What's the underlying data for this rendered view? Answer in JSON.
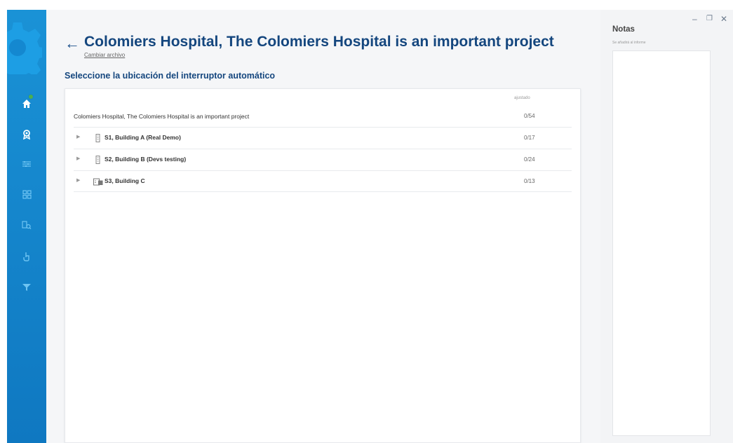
{
  "header": {
    "back_icon": "arrow-left-icon",
    "title": "Colomiers Hospital, The Colomiers Hospital is an important project",
    "change_file_link": "Cambiar archivo"
  },
  "section_title": "Seleccione la ubicación del interruptor automático",
  "table": {
    "column_header": "ajustado",
    "project": {
      "name": "Colomiers Hospital, The Colomiers Hospital is an important project",
      "count": "0/54"
    },
    "locations": [
      {
        "label": "S1, Building A (Real Demo)",
        "count": "0/17",
        "icon": "building-icon"
      },
      {
        "label": "S2, Building B (Devs testing)",
        "count": "0/24",
        "icon": "building-icon"
      },
      {
        "label": "S3, Building C",
        "count": "0/13",
        "icon": "folder-building-icon"
      }
    ]
  },
  "notes": {
    "title": "Notas",
    "hint": "Se añadirá al informe"
  },
  "sidebar": {
    "items": [
      "home-icon",
      "award-icon",
      "sliders-icon",
      "grid-icon",
      "search-icon",
      "touch-icon",
      "filter-icon"
    ],
    "home_badge_color": "#4caf50"
  },
  "colors": {
    "sidebar": "#1585cc",
    "title": "#14467e",
    "background": "#f5f6f8"
  }
}
